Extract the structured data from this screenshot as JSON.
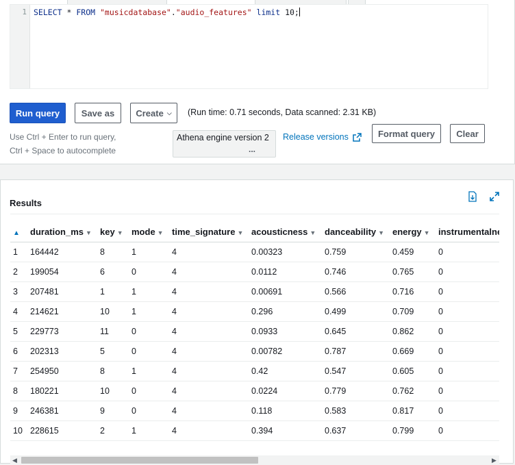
{
  "editor": {
    "line_number": "1",
    "code_keyword_select": "SELECT",
    "code_star": "*",
    "code_keyword_from": "FROM",
    "code_db": "\"musicdatabase\"",
    "code_dot": ".",
    "code_table": "\"audio_features\"",
    "code_keyword_limit": "limit",
    "code_limit_value": "10;"
  },
  "toolbar": {
    "run_query": "Run query",
    "save_as": "Save as",
    "create": "Create",
    "run_info": "(Run time: 0.71 seconds, Data scanned: 2.31 KB)",
    "hint_line1": "Use Ctrl + Enter to run query,",
    "hint_line2": "Ctrl + Space to autocomplete",
    "engine_version": "Athena engine version 2",
    "engine_more": "...",
    "release_versions": "Release versions",
    "format_query": "Format query",
    "clear": "Clear"
  },
  "icons": {
    "download": "download-results-icon",
    "expand": "expand-icon",
    "external_link": "external-link-icon",
    "sort": "sort-triangle-icon"
  },
  "results": {
    "title": "Results",
    "columns": [
      "",
      "duration_ms",
      "key",
      "mode",
      "time_signature",
      "acousticness",
      "danceability",
      "energy",
      "instrumentalne"
    ],
    "rows": [
      [
        "1",
        "164442",
        "8",
        "1",
        "4",
        "0.00323",
        "0.759",
        "0.459",
        "0"
      ],
      [
        "2",
        "199054",
        "6",
        "0",
        "4",
        "0.0112",
        "0.746",
        "0.765",
        "0"
      ],
      [
        "3",
        "207481",
        "1",
        "1",
        "4",
        "0.00691",
        "0.566",
        "0.716",
        "0"
      ],
      [
        "4",
        "214621",
        "10",
        "1",
        "4",
        "0.296",
        "0.499",
        "0.709",
        "0"
      ],
      [
        "5",
        "229773",
        "11",
        "0",
        "4",
        "0.0933",
        "0.645",
        "0.862",
        "0"
      ],
      [
        "6",
        "202313",
        "5",
        "0",
        "4",
        "0.00782",
        "0.787",
        "0.669",
        "0"
      ],
      [
        "7",
        "254950",
        "8",
        "1",
        "4",
        "0.42",
        "0.547",
        "0.605",
        "0"
      ],
      [
        "8",
        "180221",
        "10",
        "0",
        "4",
        "0.0224",
        "0.779",
        "0.762",
        "0"
      ],
      [
        "9",
        "246381",
        "9",
        "0",
        "4",
        "0.118",
        "0.583",
        "0.817",
        "0"
      ],
      [
        "10",
        "228615",
        "2",
        "1",
        "4",
        "0.394",
        "0.637",
        "0.799",
        "0"
      ]
    ]
  },
  "colors": {
    "primary_button": "#1f5ecf",
    "link": "#0073bb"
  }
}
